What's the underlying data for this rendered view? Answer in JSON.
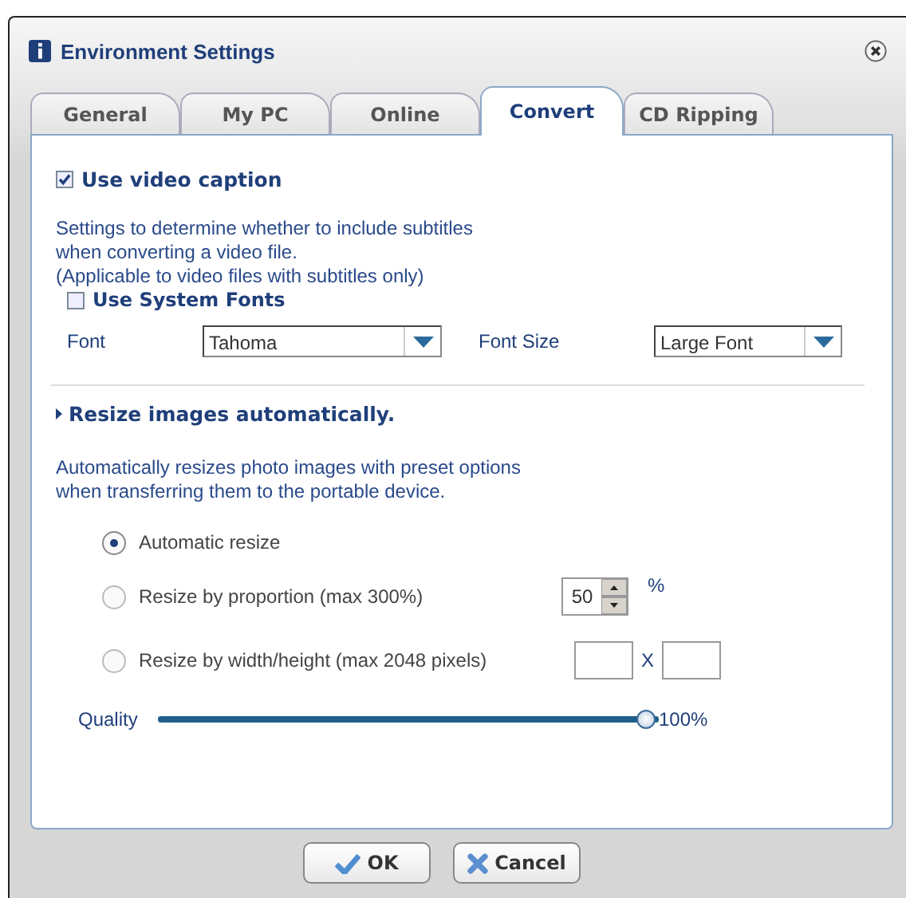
{
  "window": {
    "title": "Environment Settings"
  },
  "tabs": [
    {
      "label": "General",
      "selected": false
    },
    {
      "label": "My PC",
      "selected": false
    },
    {
      "label": "Online",
      "selected": false
    },
    {
      "label": "Convert",
      "selected": true
    },
    {
      "label": "CD Ripping",
      "selected": false
    }
  ],
  "caption": {
    "label": "Use video caption",
    "checked": true,
    "description": [
      "Settings to determine whether to include subtitles",
      "when converting a video file.",
      "(Applicable to video files with subtitles only)"
    ]
  },
  "system_fonts": {
    "label": "Use System Fonts",
    "checked": false
  },
  "font": {
    "label": "Font",
    "value": "Tahoma"
  },
  "font_size": {
    "label": "Font Size",
    "value": "Large Font"
  },
  "resize": {
    "title": "Resize images automatically.",
    "description": [
      "Automatically resizes photo images with preset options",
      "when transferring them to the portable device."
    ],
    "options": [
      {
        "kind": "plain",
        "label": "Automatic resize",
        "selected": true
      },
      {
        "kind": "proportion",
        "label": "Resize by proportion (max 300%)",
        "selected": false,
        "value": "50",
        "unit": "%"
      },
      {
        "kind": "dimensions",
        "label": "Resize by width/height (max 2048 pixels)",
        "selected": false,
        "separator": "X"
      }
    ]
  },
  "quality": {
    "label": "Quality",
    "level": 1,
    "reading": "100%"
  },
  "buttons": [
    {
      "kind": "ok",
      "label": "OK"
    },
    {
      "kind": "cancel",
      "label": "Cancel"
    }
  ]
}
